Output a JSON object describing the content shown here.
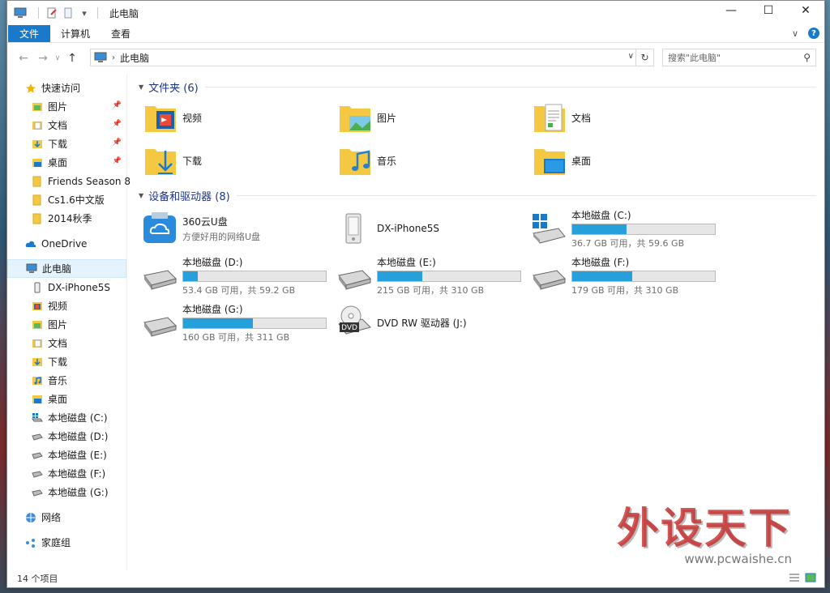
{
  "window": {
    "title": "此电脑",
    "controls": {
      "minimize": "—",
      "maximize": "☐",
      "close": "✕"
    }
  },
  "ribbon": {
    "tabs": [
      {
        "label": "文件"
      },
      {
        "label": "计算机"
      },
      {
        "label": "查看"
      }
    ],
    "expand_glyph": "∨",
    "help_glyph": "?"
  },
  "address": {
    "crumb": "此电脑",
    "search_placeholder": "搜索\"此电脑\""
  },
  "sidebar": {
    "quick_access": "快速访问",
    "quick_items": [
      {
        "label": "图片",
        "pinned": true
      },
      {
        "label": "文档",
        "pinned": true
      },
      {
        "label": "下载",
        "pinned": true
      },
      {
        "label": "桌面",
        "pinned": true
      },
      {
        "label": "Friends Season 8",
        "pinned": false
      },
      {
        "label": "Cs1.6中文版",
        "pinned": false
      },
      {
        "label": "2014秋季",
        "pinned": false
      }
    ],
    "onedrive": "OneDrive",
    "this_pc": "此电脑",
    "pc_items": [
      {
        "label": "DX-iPhone5S"
      },
      {
        "label": "视频"
      },
      {
        "label": "图片"
      },
      {
        "label": "文档"
      },
      {
        "label": "下载"
      },
      {
        "label": "音乐"
      },
      {
        "label": "桌面"
      },
      {
        "label": "本地磁盘 (C:)"
      },
      {
        "label": "本地磁盘 (D:)"
      },
      {
        "label": "本地磁盘 (E:)"
      },
      {
        "label": "本地磁盘 (F:)"
      },
      {
        "label": "本地磁盘 (G:)"
      }
    ],
    "network": "网络",
    "homegroup": "家庭组"
  },
  "folders": {
    "header": "文件夹 (6)",
    "items": [
      {
        "name": "视频"
      },
      {
        "name": "图片"
      },
      {
        "name": "文档"
      },
      {
        "name": "下载"
      },
      {
        "name": "音乐"
      },
      {
        "name": "桌面"
      }
    ]
  },
  "devices": {
    "header": "设备和驱动器 (8)",
    "items": [
      {
        "name": "360云U盘",
        "sub": "方便好用的网络U盘"
      },
      {
        "name": "DX-iPhone5S"
      },
      {
        "name": "本地磁盘 (C:)",
        "sub": "36.7 GB 可用，共 59.6 GB",
        "used_fraction": 0.38
      },
      {
        "name": "本地磁盘 (D:)",
        "sub": "53.4 GB 可用，共 59.2 GB",
        "used_fraction": 0.1
      },
      {
        "name": "本地磁盘 (E:)",
        "sub": "215 GB 可用，共 310 GB",
        "used_fraction": 0.31
      },
      {
        "name": "本地磁盘 (F:)",
        "sub": "179 GB 可用，共 310 GB",
        "used_fraction": 0.42
      },
      {
        "name": "本地磁盘 (G:)",
        "sub": "160 GB 可用，共 311 GB",
        "used_fraction": 0.49
      },
      {
        "name": "DVD RW 驱动器 (J:)",
        "badge": "DVD"
      }
    ]
  },
  "status": {
    "count": "14 个项目"
  },
  "watermark": {
    "logo": "外设天下",
    "url": "www.pcwaishe.cn"
  },
  "colors": {
    "accent": "#1979ca",
    "bar_fill": "#26a0da",
    "group_header": "#1e3287",
    "folder": "#f5c842"
  }
}
